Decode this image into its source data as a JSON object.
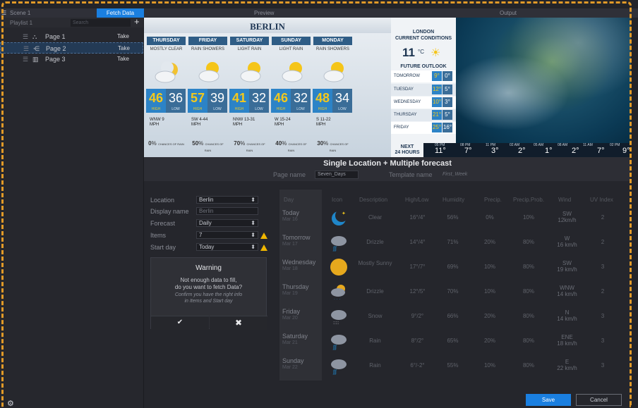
{
  "topbar": {
    "scene": "Scene 1",
    "fetch": "Fetch Data",
    "preview": "Preview",
    "output": "Output"
  },
  "playlist": {
    "name": "Playlist 1",
    "search_placeholder": "Search",
    "add": "+",
    "pages": [
      {
        "name": "Page 1",
        "take": "Take"
      },
      {
        "name": "Page 2",
        "take": "Take"
      },
      {
        "name": "Page 3",
        "take": "Take"
      }
    ]
  },
  "preview": {
    "city": "BERLIN",
    "days": [
      {
        "name": "THURSDAY",
        "cond": "MOSTLY CLEAR",
        "hi": "46",
        "lo": "36",
        "wind": "WNW 9",
        "chance": "0"
      },
      {
        "name": "FRIDAY",
        "cond": "RAIN SHOWERS",
        "hi": "57",
        "lo": "39",
        "wind": "SW 4-44",
        "chance": "50"
      },
      {
        "name": "SATURDAY",
        "cond": "LIGHT RAIN",
        "hi": "41",
        "lo": "32",
        "wind": "NNW 13-31",
        "chance": "70"
      },
      {
        "name": "SUNDAY",
        "cond": "LIGHT RAIN",
        "hi": "46",
        "lo": "32",
        "wind": "W 15-24",
        "chance": "40"
      },
      {
        "name": "MONDAY",
        "cond": "RAIN SHOWERS",
        "hi": "48",
        "lo": "34",
        "wind": "S 11-22",
        "chance": "30"
      }
    ],
    "hi_label": "HIGH",
    "lo_label": "LOW",
    "mph": "MPH",
    "chances_label": "CHANCES OF RAIN",
    "pct": "%"
  },
  "output": {
    "city": "LONDON",
    "subtitle": "CURRENT CONDITIONS",
    "temp": "11",
    "unit": "°C",
    "future": "FUTURE OUTLOOK",
    "outlook": [
      {
        "day": "TOMORROW",
        "hi": "9°",
        "lo": "0°"
      },
      {
        "day": "TUESDAY",
        "hi": "12°",
        "lo": "5°"
      },
      {
        "day": "WEDNESDAY",
        "hi": "10°",
        "lo": "3°"
      },
      {
        "day": "THURSDAY",
        "hi": "21°",
        "lo": "5°"
      },
      {
        "day": "FRIDAY",
        "hi": "25°",
        "lo": "16°"
      }
    ],
    "next1": "NEXT",
    "next2": "24 HOURS",
    "hours": [
      {
        "h": "05 PM",
        "t": "11°"
      },
      {
        "h": "08 PM",
        "t": "7°"
      },
      {
        "h": "11 PM",
        "t": "3°"
      },
      {
        "h": "02 AM",
        "t": "2°"
      },
      {
        "h": "05 AM",
        "t": "1°"
      },
      {
        "h": "08 AM",
        "t": "2°"
      },
      {
        "h": "11 AM",
        "t": "7°"
      },
      {
        "h": "02 PM",
        "t": "9°"
      }
    ]
  },
  "template": {
    "title": "Single Location + Multiple forecast",
    "page_name_label": "Page name",
    "page_name": "Seven_Days",
    "template_name_label": "Template name",
    "template_name": "First_Week"
  },
  "form": {
    "location_label": "Location",
    "location": "Berlin",
    "display_label": "Display name",
    "display_placeholder": "Berlin",
    "forecast_label": "Forecast",
    "forecast": "Daily",
    "items_label": "Items",
    "items": "7",
    "start_label": "Start day",
    "start": "Today"
  },
  "warning": {
    "title": "Warning",
    "msg1": "Not enough data to fill,",
    "msg2": "do you want to fetch Data?",
    "sub1": "Confirm you have the right info",
    "sub2": "in Items and Start day",
    "ok": "✔",
    "cancel": "✖"
  },
  "table": {
    "headers": [
      "Day",
      "Icon",
      "Description",
      "High/Low",
      "Humidity",
      "Precip.",
      "Precip.Prob.",
      "Wind",
      "UV Index"
    ],
    "rows": [
      {
        "day": "Today",
        "date": "Mar 16",
        "desc": "Clear",
        "hl": "16°/4°",
        "hum": "56%",
        "precip": "0%",
        "prob": "10%",
        "wind": "SW",
        "speed": "12km/h",
        "uv": "2"
      },
      {
        "day": "Tomorrow",
        "date": "Mar 17",
        "desc": "Drizzle",
        "hl": "14°/4°",
        "hum": "71%",
        "precip": "20%",
        "prob": "80%",
        "wind": "W",
        "speed": "16 km/h",
        "uv": "2"
      },
      {
        "day": "Wednesday",
        "date": "Mar 18",
        "desc": "Mostly Sunny",
        "hl": "17°/7°",
        "hum": "69%",
        "precip": "10%",
        "prob": "80%",
        "wind": "SW",
        "speed": "19 km/h",
        "uv": "3"
      },
      {
        "day": "Thursday",
        "date": "Mar 19",
        "desc": "Drizzle",
        "hl": "12°/5°",
        "hum": "70%",
        "precip": "10%",
        "prob": "80%",
        "wind": "WNW",
        "speed": "14 km/h",
        "uv": "2"
      },
      {
        "day": "Friday",
        "date": "Mar 20",
        "desc": "Snow",
        "hl": "9°/2°",
        "hum": "66%",
        "precip": "20%",
        "prob": "80%",
        "wind": "N",
        "speed": "14 km/h",
        "uv": "3"
      },
      {
        "day": "Saturday",
        "date": "Mar 21",
        "desc": "Rain",
        "hl": "8°/2°",
        "hum": "65%",
        "precip": "20%",
        "prob": "80%",
        "wind": "ENE",
        "speed": "18 km/h",
        "uv": "3"
      },
      {
        "day": "Sunday",
        "date": "Mar 22",
        "desc": "Rain",
        "hl": "6°/-2°",
        "hum": "55%",
        "precip": "10%",
        "prob": "80%",
        "wind": "E",
        "speed": "22 km/h",
        "uv": "3"
      }
    ]
  },
  "buttons": {
    "save": "Save",
    "cancel": "Cancel"
  }
}
